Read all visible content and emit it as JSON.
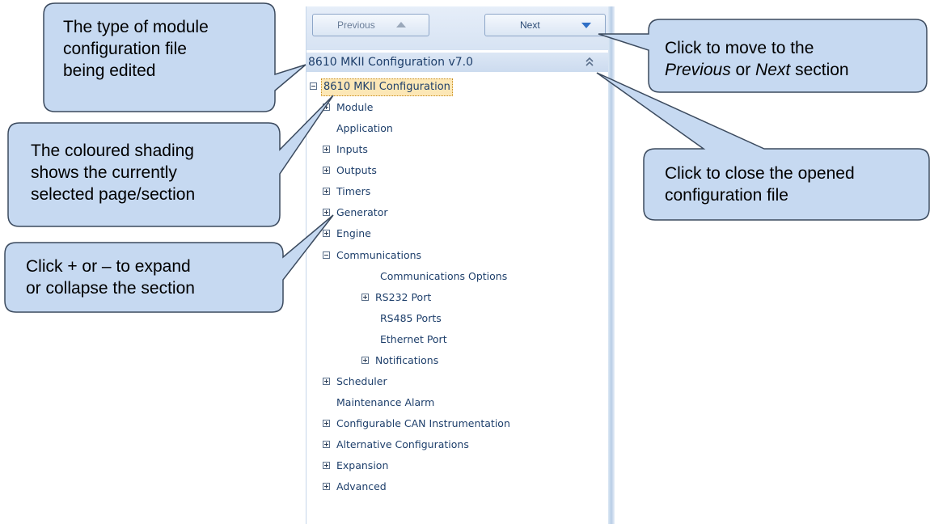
{
  "nav": {
    "previous_label": "Previous",
    "next_label": "Next"
  },
  "config": {
    "title": "8610 MKII Configuration v7.0",
    "root_label": "8610 MKII Configuration"
  },
  "tree": {
    "module": "Module",
    "application": "Application",
    "inputs": "Inputs",
    "outputs": "Outputs",
    "timers": "Timers",
    "generator": "Generator",
    "engine": "Engine",
    "communications": "Communications",
    "communications_options": "Communications Options",
    "rs232_port": "RS232 Port",
    "rs485_ports": "RS485 Ports",
    "ethernet_port": "Ethernet Port",
    "notifications": "Notifications",
    "scheduler": "Scheduler",
    "maintenance_alarm": "Maintenance Alarm",
    "configurable_can": "Configurable CAN Instrumentation",
    "alternative_configurations": "Alternative Configurations",
    "expansion": "Expansion",
    "advanced": "Advanced"
  },
  "callouts": {
    "module_type": [
      "The type of module",
      "configuration file",
      "being edited"
    ],
    "shading": [
      "The coloured shading",
      "shows the currently",
      "selected page/section"
    ],
    "expand": [
      "Click + or – to expand",
      "or collapse the section"
    ],
    "prev_next_line1": "Click to move to the",
    "prev_next_previous": "Previous",
    "prev_next_or": " or ",
    "prev_next_next": "Next",
    "prev_next_section": " section",
    "close": [
      "Click to close the opened",
      "configuration file"
    ]
  },
  "colors": {
    "callout_fill": "#c6d9f1",
    "callout_stroke": "#3b4a5e",
    "selection_fill": "#fce7b6",
    "tree_text": "#1e3f6b"
  }
}
